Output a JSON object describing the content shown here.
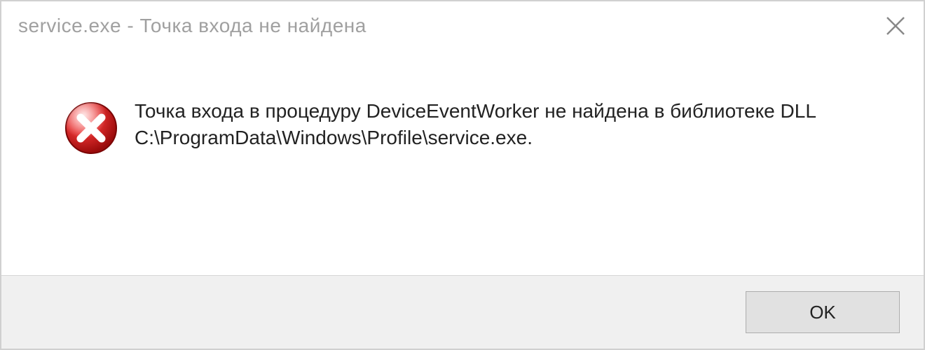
{
  "titlebar": {
    "title": "service.exe - Точка входа не найдена"
  },
  "body": {
    "message": "Точка входа в процедуру DeviceEventWorker не найдена в библиотеке DLL C:\\ProgramData\\Windows\\Profile\\service.exe.",
    "icon": "error-icon"
  },
  "footer": {
    "ok_label": "OK"
  }
}
